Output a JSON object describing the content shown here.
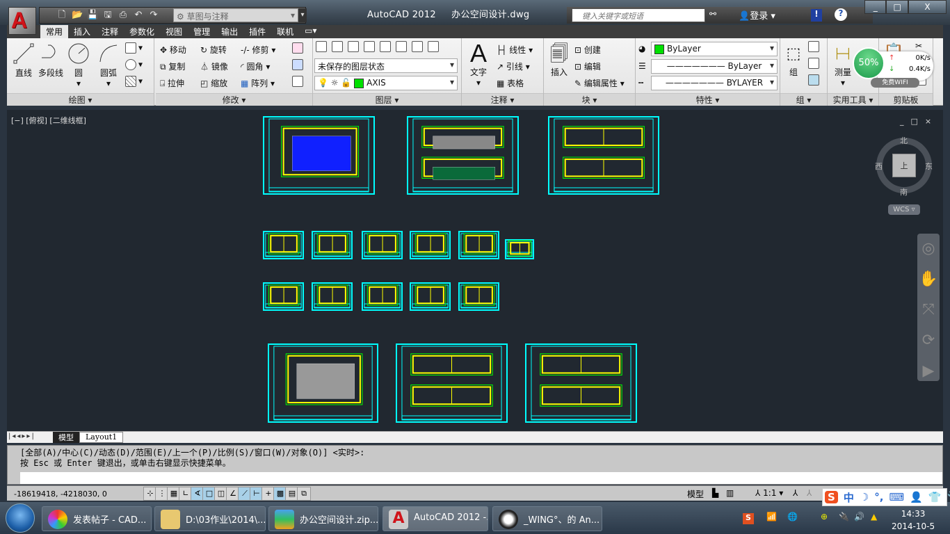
{
  "app": {
    "title": "AutoCAD 2012",
    "document": "办公空间设计.dwg",
    "logo": "A"
  },
  "qat": {
    "icons": [
      "new-icon",
      "open-icon",
      "save-icon",
      "saveas-icon",
      "print-icon",
      "undo-icon",
      "redo-icon"
    ],
    "workspace": "草图与注释"
  },
  "search": {
    "placeholder": "键入关键字或短语",
    "login": "登录"
  },
  "window_buttons": [
    "_",
    "□",
    "X"
  ],
  "tabs": [
    "常用",
    "插入",
    "注释",
    "参数化",
    "视图",
    "管理",
    "输出",
    "插件",
    "联机"
  ],
  "ribbon": {
    "draw": {
      "title": "绘图",
      "line": "直线",
      "polyline": "多段线",
      "circle": "圆",
      "arc": "圆弧"
    },
    "modify": {
      "title": "修改",
      "move": "移动",
      "rotate": "旋转",
      "trim": "修剪",
      "copy": "复制",
      "mirror": "镜像",
      "fillet": "圆角",
      "stretch": "拉伸",
      "scale": "缩放",
      "array": "阵列"
    },
    "layers": {
      "title": "图层",
      "state": "未保存的图层状态",
      "layer": "AXIS"
    },
    "annotation": {
      "title": "注释",
      "text": "文字",
      "linear": "线性",
      "leader": "引线",
      "table": "表格"
    },
    "block": {
      "title": "块",
      "insert": "插入",
      "create": "创建",
      "edit": "编辑",
      "edit_attr": "编辑属性"
    },
    "properties": {
      "title": "特性",
      "color": "ByLayer",
      "lineweight": "ByLayer",
      "linetype": "BYLAYER"
    },
    "group": {
      "title": "组",
      "group": "组"
    },
    "utilities": {
      "title": "实用工具",
      "measure": "测量"
    },
    "clipboard": {
      "title": "剪贴板"
    }
  },
  "network_widget": {
    "percent": "50%",
    "up": "0K/s",
    "down": "0.4K/s",
    "wifi": "免费WIFI"
  },
  "viewport": {
    "label": "[−] [俯视] [二维线框]",
    "compass": {
      "n": "北",
      "s": "南",
      "e": "东",
      "w": "西",
      "top": "上"
    },
    "ucs": "WCS",
    "controls": [
      "_",
      "□",
      "×"
    ]
  },
  "layout_tabs": [
    "模型",
    "Layout1"
  ],
  "command": {
    "line1": "[全部(A)/中心(C)/动态(D)/范围(E)/上一个(P)/比例(S)/窗口(W)/对象(O)] <实时>:",
    "line2": "按 Esc 或 Enter 键退出，或单击右键显示快捷菜单。"
  },
  "status": {
    "coords": "-18619418, -4218030, 0",
    "model": "模型",
    "scale": "1:1"
  },
  "ime": {
    "lang": "中"
  },
  "taskbar": {
    "items": [
      "发表帖子 - CAD...",
      "D:\\03作业\\2014\\...",
      "办公空间设计.zip...",
      "AutoCAD 2012 -...",
      "_WING°、的 An..."
    ],
    "time": "14:33",
    "date": "2014-10-5"
  },
  "colors": {
    "frame": "#00ffff",
    "wall": "#ffff00",
    "dim": "#00ff00",
    "viewport_bg": "#212830",
    "accent": "#d0141a"
  }
}
